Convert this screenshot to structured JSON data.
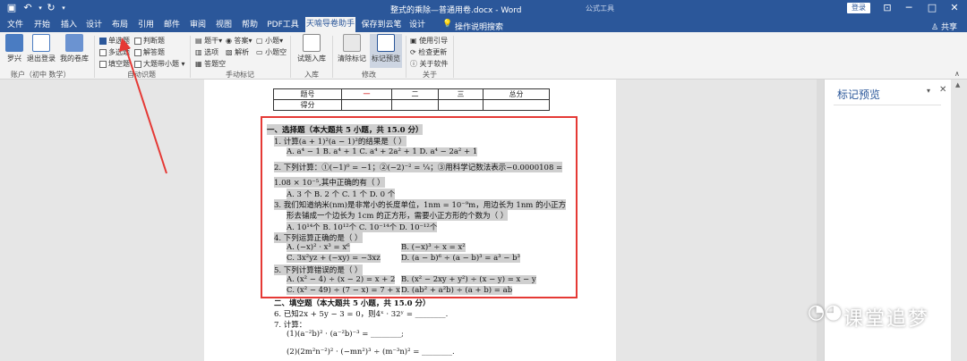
{
  "titlebar": {
    "title": "整式的乘除—普通用卷.docx - Word",
    "context_label": "公式工具",
    "login": "登录"
  },
  "tabs": [
    "文件",
    "开始",
    "插入",
    "设计",
    "布局",
    "引用",
    "邮件",
    "审阅",
    "视图",
    "帮助",
    "PDF工具集",
    "天喻导卷助手",
    "保存到云笔记",
    "设计"
  ],
  "active_tab": "天喻导卷助手",
  "tell_me": "操作说明搜索",
  "share": "共享",
  "ribbon": {
    "account": {
      "b1": "罗兴",
      "b2": "退出登录",
      "b3": "我的卷库",
      "label": "账户（初中 数学）"
    },
    "auto": {
      "c1": "单选题",
      "c2": "判断题",
      "c3": "多选题",
      "c4": "解答题",
      "c5": "填空题",
      "c6": "大题带小题",
      "label": "自动识题"
    },
    "manual": {
      "m1": "题干",
      "m2": "答案",
      "m3": "小题",
      "m4": "选项",
      "m5": "解析",
      "m6": "小题空",
      "m7": "答题空",
      "label": "手动标记"
    },
    "import": {
      "b1": "试题入库",
      "label": "入库"
    },
    "modify": {
      "b1": "清除标记",
      "b2": "标记预览",
      "label": "修改"
    },
    "about": {
      "a1": "使用引导",
      "a2": "检查更新",
      "a3": "关于软件",
      "label": "关于"
    }
  },
  "panel": {
    "title": "标记预览"
  },
  "watermark": "课堂追梦",
  "score_table": {
    "header": [
      "题号",
      "一",
      "二",
      "三",
      "总分"
    ],
    "row": [
      "得分",
      "",
      "",
      "",
      ""
    ]
  },
  "content": {
    "sec1": "一、选择题（本大题共 5 小题，共 15.0 分）",
    "q1": "1.    计算(a + 1)²(a − 1)²的结果是（      ）",
    "q1opts": "A.   a⁴ − 1      B.  a⁴ + 1      C.  a⁴ + 2a² + 1      D.  a⁴ − 2a² + 1",
    "q2": "2.    下列计算：①(−1)⁰ = −1；②(−2)⁻² = ¼；③用科学记数法表示−0.0000108 =",
    "q2b": "1.08 × 10⁻⁵,其中正确的有（      ）",
    "q2opts": "A. 3 个       B. 2 个       C. 1 个       D. 0 个",
    "q3": "3.    我们知道纳米(nm)是非常小的长度单位，1nm = 10⁻⁹m，用边长为 1nm 的小正方",
    "q3b": "形去铺成一个边长为 1cm 的正方形，需要小正方形的个数为（      ）",
    "q3opts": "A.  10¹⁴个       B.  10¹²个       C.  10⁻¹⁴个       D.  10⁻¹²个",
    "q4": "4.    下列运算正确的是（      ）",
    "q4a": "A.  (−x)² · x³ = x⁶",
    "q4b": "B.  (−x)³ ÷ x = x²",
    "q4c": "C.  3x²yz + (−xy) = −3xz",
    "q4d": "D.  (a − b)⁶ ÷ (a − b)³ = a³ − b³",
    "q5": "5.    下列计算错误的是（      ）",
    "q5a": "A.  (x² − 4) ÷ (x − 2) = x + 2",
    "q5b": "B.  (x² − 2xy + y²) ÷ (x − y) = x − y",
    "q5c": "C.  (x² − 49) ÷ (7 − x) = 7 + x",
    "q5d": "D.  (ab² + a²b) ÷ (a + b) = ab",
    "sec2": "二、填空题（本大题共 5 小题，共 15.0 分）",
    "q6": "6.    已知2x + 5y − 3 = 0，则4ˣ · 32ʸ = ________.",
    "q7": "7.    计算：",
    "q7a": "(1)(a⁻²b)² · (a⁻²b)⁻³ = ________;",
    "q7b": "(2)(2m²n⁻²)² · (−mn²)³ ÷ (m⁻³n)² = ________."
  },
  "colors": {
    "accent": "#2b579a",
    "highlight_box": "#e53935",
    "arrow": "#e53935"
  }
}
